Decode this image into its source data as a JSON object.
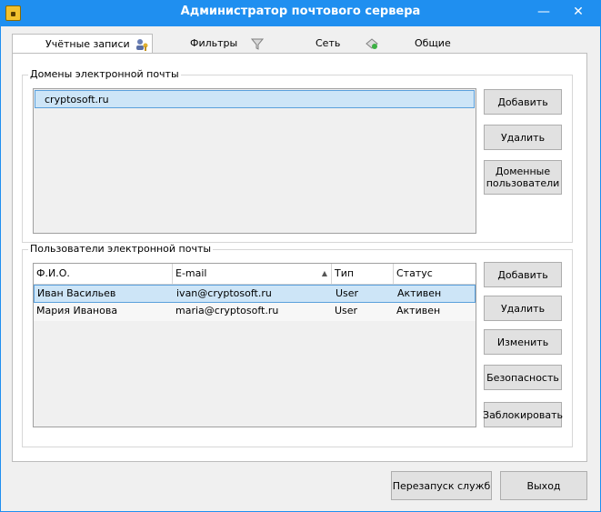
{
  "window": {
    "title": "Администратор почтового сервера",
    "minimize_glyph": "—",
    "close_glyph": "✕"
  },
  "tabs": [
    {
      "label": "Учётные записи",
      "icon": "users-key-icon",
      "active": true
    },
    {
      "label": "Фильтры",
      "icon": "funnel-icon",
      "active": false
    },
    {
      "label": "Сеть",
      "icon": "network-icon",
      "active": false
    },
    {
      "label": "Общие",
      "icon": "general-icon",
      "active": false
    }
  ],
  "domains": {
    "caption": "Домены электронной почты",
    "items": [
      "cryptosoft.ru"
    ],
    "selected_index": 0,
    "add_label": "Добавить",
    "delete_label": "Удалить",
    "domain_users_label": "Доменные пользователи"
  },
  "users": {
    "caption": "Пользователи электронной почты",
    "columns": [
      "Ф.И.О.",
      "E-mail",
      "Тип",
      "Статус"
    ],
    "sorted_column": 1,
    "rows": [
      [
        "Иван Васильев",
        "ivan@cryptosoft.ru",
        "User",
        "Активен"
      ],
      [
        "Мария Иванова",
        "maria@cryptosoft.ru",
        "User",
        "Активен"
      ]
    ],
    "selected_index": 0,
    "add_label": "Добавить",
    "delete_label": "Удалить",
    "edit_label": "Изменить",
    "security_label": "Безопасность",
    "block_label": "Заблокировать"
  },
  "footer": {
    "restart_label": "Перезапуск служб",
    "exit_label": "Выход"
  },
  "colors": {
    "titlebar": "#1f8ff0",
    "selection": "#cde5f7",
    "selection_border": "#5aa0dc"
  }
}
